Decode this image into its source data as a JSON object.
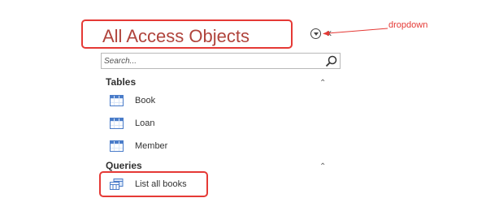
{
  "nav_pane": {
    "title": "All Access Objects",
    "dropdown_icon": "circle-chevron-down-icon",
    "collapse_icon": "double-chevron-left-icon",
    "collapse_glyph": "«",
    "search": {
      "placeholder": "Search...",
      "value": ""
    },
    "groups": [
      {
        "label": "Tables",
        "toggle_glyph": "⌃",
        "items": [
          {
            "label": "Book",
            "icon": "table-icon"
          },
          {
            "label": "Loan",
            "icon": "table-icon"
          },
          {
            "label": "Member",
            "icon": "table-icon"
          }
        ]
      },
      {
        "label": "Queries",
        "toggle_glyph": "⌃",
        "items": [
          {
            "label": "List all books",
            "icon": "query-icon"
          }
        ]
      }
    ]
  },
  "annotation": {
    "text": "dropdown",
    "color": "#e53935"
  },
  "colors": {
    "title": "#b0443c",
    "highlight": "#e53935",
    "table_icon": "#4a7cc9"
  }
}
